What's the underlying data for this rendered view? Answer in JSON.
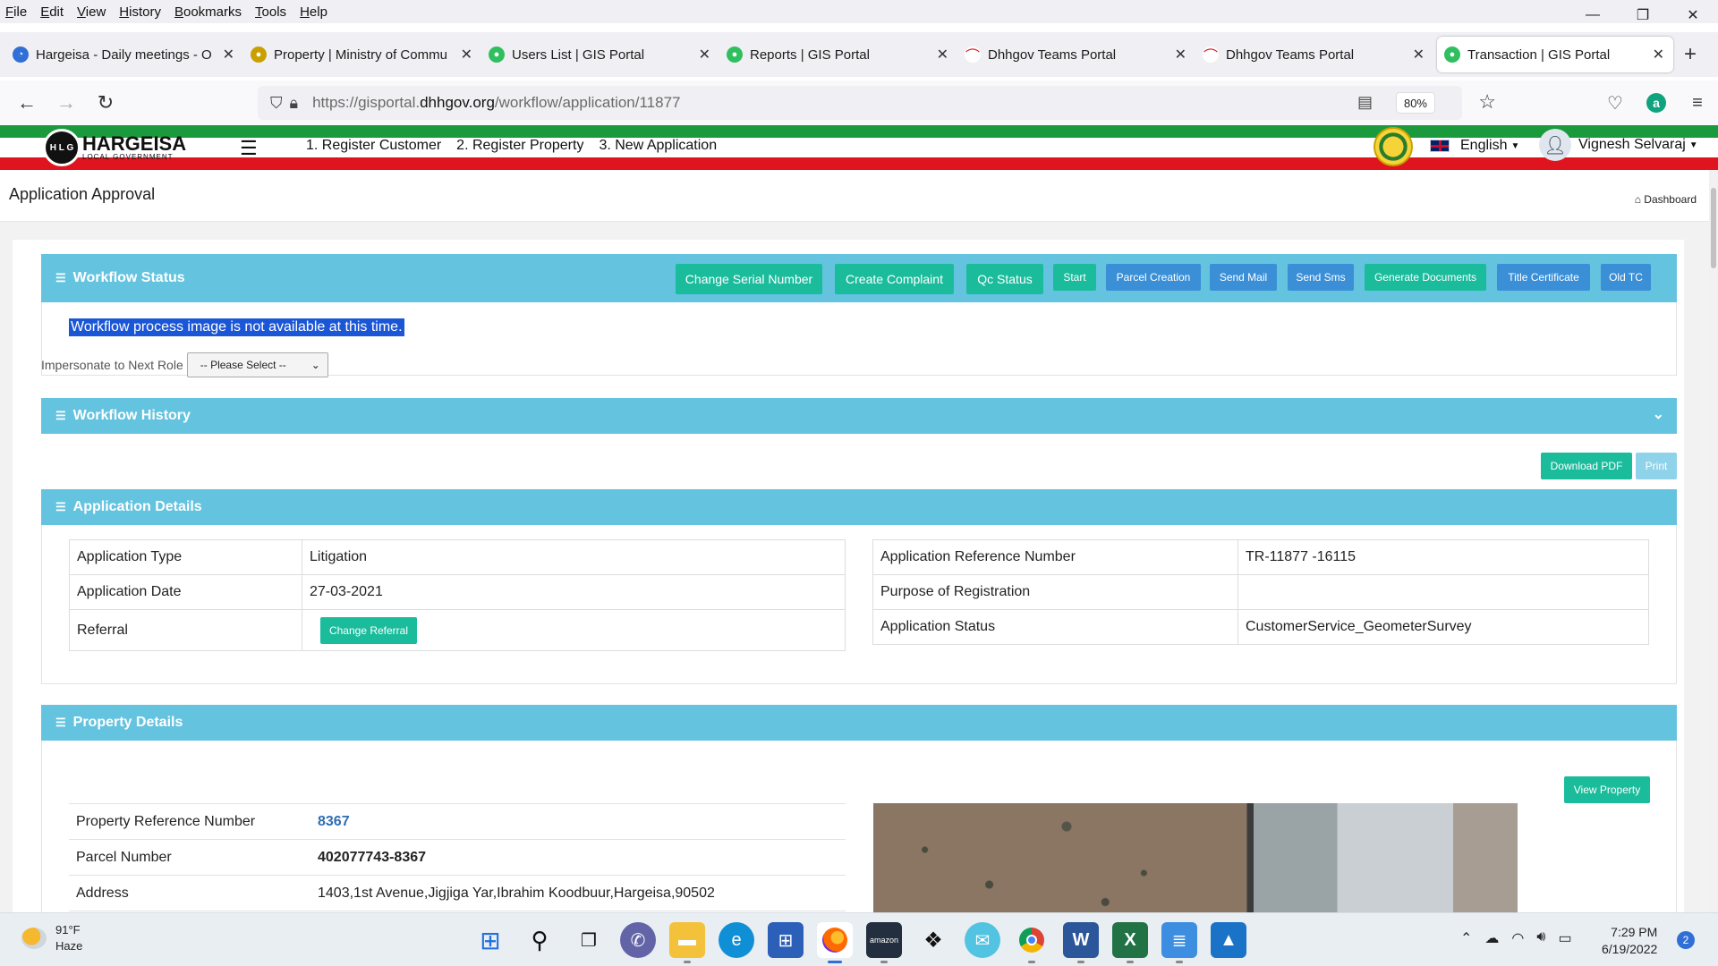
{
  "browser": {
    "menu": [
      "File",
      "Edit",
      "View",
      "History",
      "Bookmarks",
      "Tools",
      "Help"
    ],
    "window_controls": [
      "—",
      "❐",
      "✕"
    ],
    "tabs": [
      {
        "title": "Hargeisa - Daily meetings - O",
        "favicon_color": "#2f6fd6",
        "active": false
      },
      {
        "title": "Property | Ministry of Commu",
        "favicon_color": "#c9a000",
        "active": false
      },
      {
        "title": "Users List | GIS Portal",
        "favicon_color": "#2fbf5f",
        "active": false
      },
      {
        "title": "Reports | GIS Portal",
        "favicon_color": "#2fbf5f",
        "active": false
      },
      {
        "title": "Dhhgov Teams Portal",
        "favicon_color": "#e0141e",
        "active": false
      },
      {
        "title": "Dhhgov Teams Portal",
        "favicon_color": "#e0141e",
        "active": false
      },
      {
        "title": "Transaction | GIS Portal",
        "favicon_color": "#2fbf5f",
        "active": true
      }
    ],
    "new_tab": "+",
    "url_prefix": "https://gisportal.",
    "url_domain": "dhhgov.org",
    "url_path": "/workflow/application/11877",
    "zoom": "80%"
  },
  "header": {
    "logo_title": "HARGEISA",
    "logo_subtitle": "LOCAL GOVERNMENT",
    "logo_mark": "H L G",
    "nav": [
      "1. Register Customer",
      "2. Register Property",
      "3. New Application"
    ],
    "language": "English",
    "user_name": "Vignesh Selvaraj"
  },
  "page": {
    "title": "Application Approval",
    "breadcrumb": "Dashboard"
  },
  "workflow_status": {
    "heading": "Workflow Status",
    "buttons": {
      "change_serial": "Change Serial Number",
      "create_complaint": "Create Complaint",
      "qc_status": "Qc Status",
      "start": "Start",
      "parcel_creation": "Parcel Creation",
      "send_mail": "Send Mail",
      "send_sms": "Send Sms",
      "generate_documents": "Generate Documents",
      "title_certificate": "Title Certificate",
      "old_tc": "Old TC"
    },
    "message": "Workflow process image is not available at this time.",
    "impersonate_label": "Impersonate to Next Role",
    "impersonate_selected": "-- Please Select --"
  },
  "workflow_history": {
    "heading": "Workflow History"
  },
  "actions": {
    "download_pdf": "Download PDF",
    "print": "Print"
  },
  "application_details": {
    "heading": "Application Details",
    "left": [
      {
        "label": "Application Type",
        "value": "Litigation"
      },
      {
        "label": "Application Date",
        "value": "27-03-2021"
      },
      {
        "label": "Referral",
        "button": "Change Referral"
      }
    ],
    "right": [
      {
        "label": "Application Reference Number",
        "value": "TR-11877 -16115"
      },
      {
        "label": "Purpose of Registration",
        "value": ""
      },
      {
        "label": "Application Status",
        "value": "CustomerService_GeometerSurvey"
      }
    ]
  },
  "property_details": {
    "heading": "Property Details",
    "view_property": "View Property",
    "rows": [
      {
        "label": "Property Reference Number",
        "value": "8367"
      },
      {
        "label": "Parcel Number",
        "value": "402077743-8367"
      },
      {
        "label": "Address",
        "value": "1403,1st Avenue,Jigjiga Yar,Ibrahim Koodbuur,Hargeisa,90502"
      }
    ]
  },
  "taskbar": {
    "weather_temp": "91°F",
    "weather_desc": "Haze",
    "time": "7:29 PM",
    "date": "6/19/2022",
    "notifications": "2"
  }
}
